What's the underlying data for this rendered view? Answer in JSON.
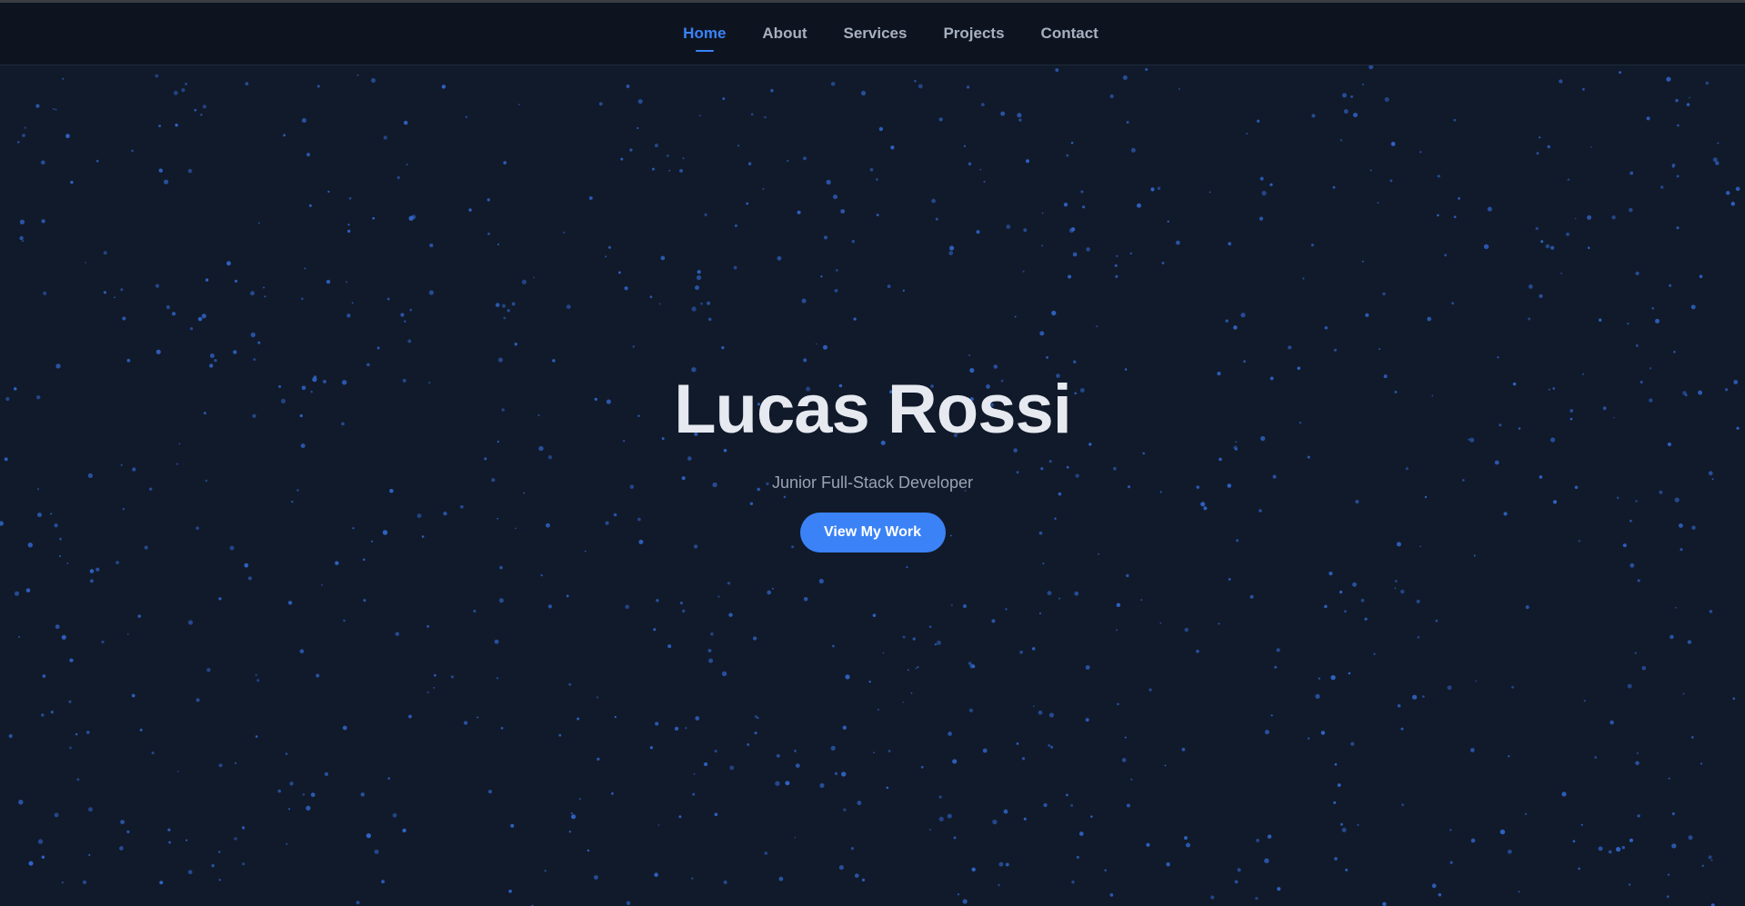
{
  "nav": {
    "items": [
      {
        "label": "Home",
        "active": true
      },
      {
        "label": "About",
        "active": false
      },
      {
        "label": "Services",
        "active": false
      },
      {
        "label": "Projects",
        "active": false
      },
      {
        "label": "Contact",
        "active": false
      }
    ]
  },
  "hero": {
    "title": "Lucas Rossi",
    "subtitle": "Junior Full-Stack Developer",
    "cta_label": "View My Work"
  },
  "colors": {
    "background": "#111a2b",
    "navbar": "#0d1420",
    "accent": "#3b82f6",
    "star": "#2f63c4",
    "title": "#e6e9ef",
    "subtitle": "#9aa3b2"
  }
}
